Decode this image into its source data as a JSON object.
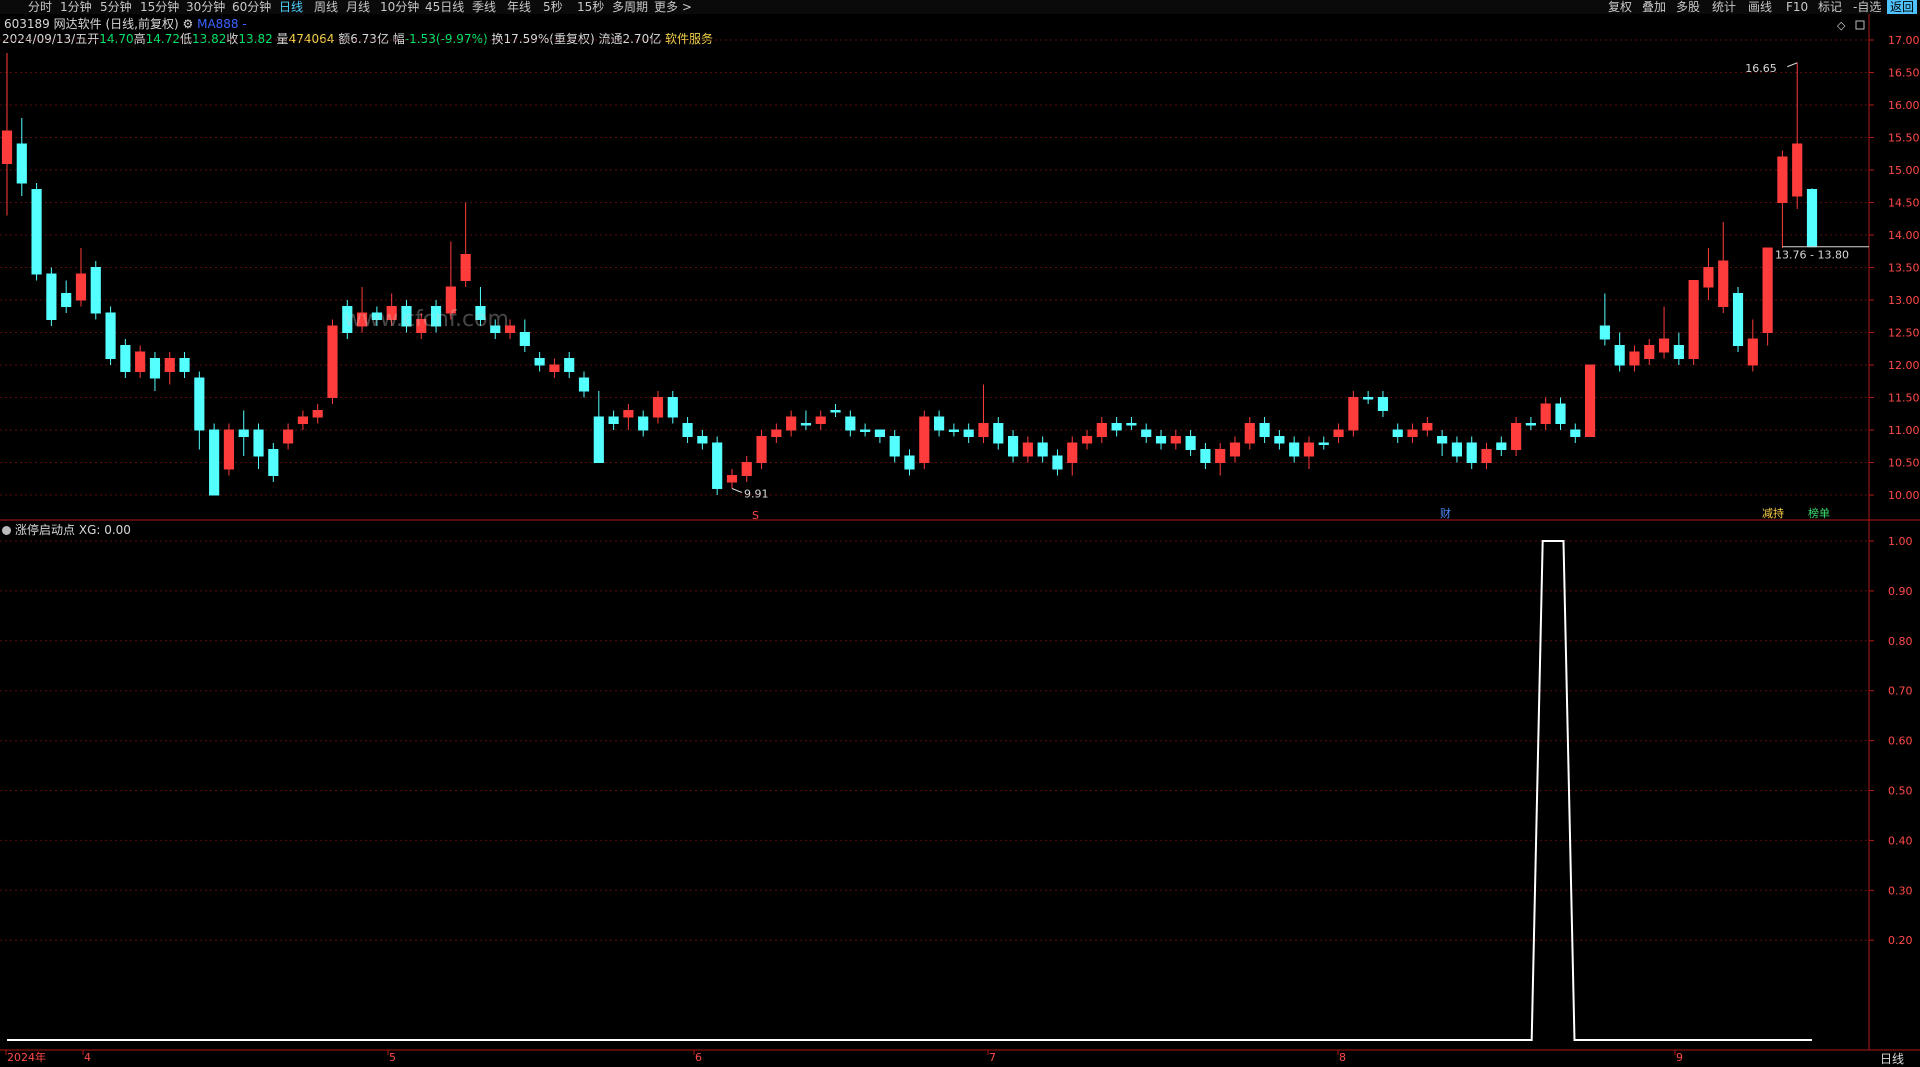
{
  "toolbar": {
    "periods": [
      "分时",
      "1分钟",
      "5分钟",
      "15分钟",
      "30分钟",
      "60分钟",
      "日线",
      "周线",
      "月线",
      "10分钟",
      "45日线",
      "季线",
      "年线",
      "5秒",
      "15秒",
      "多周期",
      "更多 >"
    ],
    "active_period": "日线",
    "right": [
      "复权",
      "叠加",
      "多股",
      "统计",
      "画线",
      "F10",
      "标记",
      "-自选",
      "返回"
    ],
    "right_selected": "返回"
  },
  "stock": {
    "code": "603189",
    "name": "网达软件",
    "period_text": "(日线,前复权)",
    "ma_label": "MA888",
    "date": "2024/09/13/五",
    "open_label": "开",
    "open": "14.70",
    "high_label": "高",
    "high": "14.72",
    "low_label": "低",
    "low": "13.82",
    "close_label": "收",
    "close": "13.82",
    "vol_label": "量",
    "vol": "474064",
    "amt_label": "额",
    "amt": "6.73亿",
    "chg_label": "幅",
    "chg": "-1.53(-9.97%)",
    "turn_label": "换",
    "turn": "17.59%(重复权)",
    "float_label": "流通",
    "float": "2.70亿",
    "service": "软件服务"
  },
  "watermark": "www.cfcnf.com",
  "main_chart": {
    "y_ticks": [
      "17.00",
      "16.50",
      "16.00",
      "15.50",
      "15.00",
      "14.50",
      "14.00",
      "13.50",
      "13.00",
      "12.50",
      "12.00",
      "11.50",
      "11.00",
      "10.50",
      "10.00"
    ],
    "high_marker": "16.65",
    "low_marker": "9.91",
    "cursor_label": "13.76 - 13.80",
    "markers": {
      "s": "S",
      "cai": "财",
      "jianchi": "减持",
      "bangdan": "榜单"
    }
  },
  "indicator": {
    "title": "涨停启动点",
    "value_label": "XG: 0.00",
    "y_ticks": [
      "1.00",
      "0.90",
      "0.80",
      "0.70",
      "0.60",
      "0.50",
      "0.40",
      "0.30",
      "0.20"
    ]
  },
  "x_axis": {
    "labels": [
      "2024年",
      "4",
      "5",
      "6",
      "7",
      "8",
      "9"
    ]
  },
  "timeframe_label": "日线",
  "chart_data": {
    "type": "candlestick",
    "price_range": [
      9.8,
      17.2
    ],
    "candles": [
      [
        15.1,
        15.6,
        16.8,
        14.3
      ],
      [
        15.4,
        14.8,
        15.8,
        14.6
      ],
      [
        14.7,
        13.4,
        14.8,
        13.3
      ],
      [
        13.4,
        12.7,
        13.5,
        12.6
      ],
      [
        13.1,
        12.9,
        13.3,
        12.8
      ],
      [
        13.0,
        13.4,
        13.8,
        12.9
      ],
      [
        13.5,
        12.8,
        13.6,
        12.7
      ],
      [
        12.8,
        12.1,
        12.9,
        12.0
      ],
      [
        12.3,
        11.9,
        12.4,
        11.8
      ],
      [
        11.9,
        12.2,
        12.3,
        11.8
      ],
      [
        12.1,
        11.8,
        12.2,
        11.6
      ],
      [
        11.9,
        12.1,
        12.2,
        11.7
      ],
      [
        12.1,
        11.9,
        12.2,
        11.8
      ],
      [
        11.8,
        11.0,
        11.9,
        10.7
      ],
      [
        11.0,
        10.0,
        11.1,
        10.0
      ],
      [
        10.4,
        11.0,
        11.1,
        10.3
      ],
      [
        11.0,
        10.9,
        11.3,
        10.6
      ],
      [
        11.0,
        10.6,
        11.1,
        10.4
      ],
      [
        10.7,
        10.3,
        10.8,
        10.2
      ],
      [
        10.8,
        11.0,
        11.1,
        10.7
      ],
      [
        11.1,
        11.2,
        11.3,
        11.0
      ],
      [
        11.2,
        11.3,
        11.4,
        11.1
      ],
      [
        11.5,
        12.6,
        12.7,
        11.4
      ],
      [
        12.9,
        12.5,
        13.0,
        12.4
      ],
      [
        12.6,
        12.8,
        13.2,
        12.5
      ],
      [
        12.8,
        12.7,
        12.9,
        12.6
      ],
      [
        12.7,
        12.9,
        13.1,
        12.6
      ],
      [
        12.9,
        12.6,
        13.0,
        12.5
      ],
      [
        12.5,
        12.7,
        12.8,
        12.4
      ],
      [
        12.9,
        12.6,
        13.0,
        12.5
      ],
      [
        12.8,
        13.2,
        13.9,
        12.7
      ],
      [
        13.3,
        13.7,
        14.5,
        13.2
      ],
      [
        12.9,
        12.7,
        13.2,
        12.6
      ],
      [
        12.6,
        12.5,
        12.7,
        12.4
      ],
      [
        12.5,
        12.6,
        12.7,
        12.4
      ],
      [
        12.5,
        12.3,
        12.7,
        12.2
      ],
      [
        12.1,
        12.0,
        12.2,
        11.9
      ],
      [
        11.9,
        12.0,
        12.1,
        11.8
      ],
      [
        12.1,
        11.9,
        12.2,
        11.8
      ],
      [
        11.8,
        11.6,
        11.9,
        11.5
      ],
      [
        11.2,
        10.5,
        11.6,
        10.5
      ],
      [
        11.2,
        11.1,
        11.3,
        11.0
      ],
      [
        11.2,
        11.3,
        11.4,
        11.0
      ],
      [
        11.2,
        11.0,
        11.3,
        10.9
      ],
      [
        11.2,
        11.5,
        11.6,
        11.1
      ],
      [
        11.5,
        11.2,
        11.6,
        11.1
      ],
      [
        11.1,
        10.9,
        11.2,
        10.8
      ],
      [
        10.9,
        10.8,
        11.0,
        10.7
      ],
      [
        10.8,
        10.1,
        10.9,
        10.0
      ],
      [
        10.2,
        10.3,
        10.4,
        10.1
      ],
      [
        10.3,
        10.5,
        10.6,
        10.2
      ],
      [
        10.5,
        10.9,
        11.0,
        10.4
      ],
      [
        10.9,
        11.0,
        11.1,
        10.8
      ],
      [
        11.0,
        11.2,
        11.3,
        10.9
      ],
      [
        11.1,
        11.1,
        11.3,
        11.0
      ],
      [
        11.1,
        11.2,
        11.3,
        11.0
      ],
      [
        11.3,
        11.3,
        11.4,
        11.2
      ],
      [
        11.2,
        11.0,
        11.3,
        10.9
      ],
      [
        11.0,
        11.0,
        11.1,
        10.9
      ],
      [
        11.0,
        10.9,
        11.0,
        10.8
      ],
      [
        10.9,
        10.6,
        11.0,
        10.5
      ],
      [
        10.6,
        10.4,
        10.7,
        10.3
      ],
      [
        10.5,
        11.2,
        11.3,
        10.4
      ],
      [
        11.2,
        11.0,
        11.3,
        10.9
      ],
      [
        11.0,
        11.0,
        11.1,
        10.9
      ],
      [
        11.0,
        10.9,
        11.1,
        10.8
      ],
      [
        10.9,
        11.1,
        11.7,
        10.8
      ],
      [
        11.1,
        10.8,
        11.2,
        10.7
      ],
      [
        10.9,
        10.6,
        11.0,
        10.5
      ],
      [
        10.6,
        10.8,
        10.9,
        10.5
      ],
      [
        10.8,
        10.6,
        10.9,
        10.5
      ],
      [
        10.6,
        10.4,
        10.7,
        10.3
      ],
      [
        10.5,
        10.8,
        10.9,
        10.3
      ],
      [
        10.8,
        10.9,
        11.0,
        10.7
      ],
      [
        10.9,
        11.1,
        11.2,
        10.8
      ],
      [
        11.1,
        11.0,
        11.2,
        10.9
      ],
      [
        11.1,
        11.1,
        11.2,
        11.0
      ],
      [
        11.0,
        10.9,
        11.1,
        10.8
      ],
      [
        10.9,
        10.8,
        11.0,
        10.7
      ],
      [
        10.8,
        10.9,
        11.0,
        10.7
      ],
      [
        10.9,
        10.7,
        11.0,
        10.6
      ],
      [
        10.7,
        10.5,
        10.8,
        10.4
      ],
      [
        10.5,
        10.7,
        10.8,
        10.3
      ],
      [
        10.6,
        10.8,
        10.9,
        10.5
      ],
      [
        10.8,
        11.1,
        11.2,
        10.7
      ],
      [
        11.1,
        10.9,
        11.2,
        10.8
      ],
      [
        10.9,
        10.8,
        11.0,
        10.7
      ],
      [
        10.8,
        10.6,
        10.9,
        10.5
      ],
      [
        10.6,
        10.8,
        10.9,
        10.4
      ],
      [
        10.8,
        10.8,
        10.9,
        10.7
      ],
      [
        10.9,
        11.0,
        11.1,
        10.8
      ],
      [
        11.0,
        11.5,
        11.6,
        10.9
      ],
      [
        11.5,
        11.5,
        11.6,
        11.4
      ],
      [
        11.5,
        11.3,
        11.6,
        11.2
      ],
      [
        11.0,
        10.9,
        11.1,
        10.8
      ],
      [
        10.9,
        11.0,
        11.1,
        10.8
      ],
      [
        11.0,
        11.1,
        11.2,
        10.9
      ],
      [
        10.9,
        10.8,
        11.0,
        10.6
      ],
      [
        10.8,
        10.6,
        10.9,
        10.5
      ],
      [
        10.8,
        10.5,
        10.9,
        10.4
      ],
      [
        10.5,
        10.7,
        10.8,
        10.4
      ],
      [
        10.8,
        10.7,
        10.9,
        10.6
      ],
      [
        10.7,
        11.1,
        11.2,
        10.6
      ],
      [
        11.1,
        11.1,
        11.2,
        11.0
      ],
      [
        11.1,
        11.4,
        11.5,
        11.0
      ],
      [
        11.4,
        11.1,
        11.5,
        11.0
      ],
      [
        11.0,
        10.9,
        11.1,
        10.8
      ],
      [
        10.9,
        12.0,
        12.0,
        10.9
      ],
      [
        12.6,
        12.4,
        13.1,
        12.3
      ],
      [
        12.3,
        12.0,
        12.5,
        11.9
      ],
      [
        12.0,
        12.2,
        12.3,
        11.9
      ],
      [
        12.1,
        12.3,
        12.4,
        12.0
      ],
      [
        12.2,
        12.4,
        12.9,
        12.1
      ],
      [
        12.3,
        12.1,
        12.5,
        12.0
      ],
      [
        12.1,
        13.3,
        13.3,
        12.0
      ],
      [
        13.2,
        13.5,
        13.8,
        13.0
      ],
      [
        12.9,
        13.6,
        14.2,
        12.8
      ],
      [
        13.1,
        12.3,
        13.2,
        12.2
      ],
      [
        12.0,
        12.4,
        12.7,
        11.9
      ],
      [
        12.5,
        13.8,
        13.8,
        12.3
      ],
      [
        14.5,
        15.2,
        15.3,
        13.8
      ],
      [
        14.6,
        15.4,
        16.65,
        14.4
      ],
      [
        14.7,
        13.82,
        14.72,
        13.82
      ]
    ],
    "indicator_series": {
      "name": "XG",
      "spike_start_index": 104,
      "spike_end_index": 105,
      "values_default": 0,
      "spike_value": 1
    }
  }
}
